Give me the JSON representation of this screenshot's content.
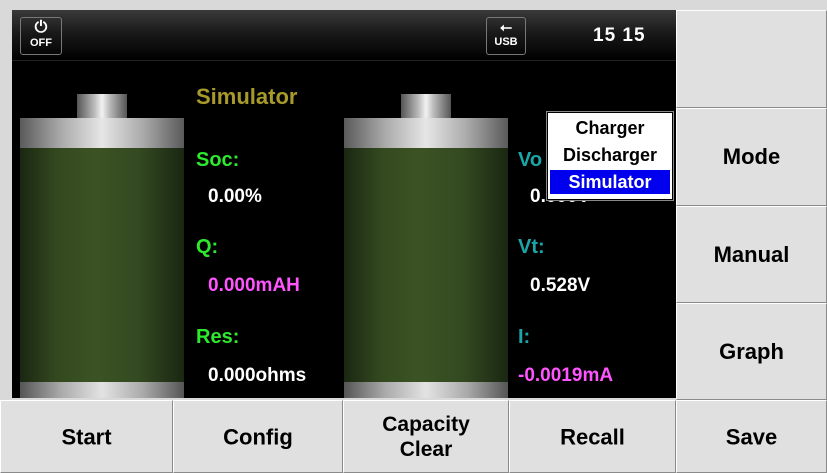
{
  "status": {
    "power_icon": "power-icon",
    "power_label": "OFF",
    "usb_icon": "usb-icon",
    "usb_label": "USB",
    "clock": "15 15"
  },
  "mode_title": "Simulator",
  "left_panel": {
    "soc_label": "Soc:",
    "soc_value": "0.00%",
    "q_label": "Q:",
    "q_value": "0.000mAH",
    "res_label": "Res:",
    "res_value": "0.000ohms"
  },
  "right_panel": {
    "voc_label": "Vo",
    "voc_value": "0.000V",
    "vt_label": "Vt:",
    "vt_value": "0.528V",
    "i_label": "I:",
    "i_value": "-0.0019mA"
  },
  "mode_popup": {
    "options": [
      "Charger",
      "Discharger",
      "Simulator"
    ],
    "selected": "Simulator"
  },
  "side_buttons": {
    "mode": "Mode",
    "manual": "Manual",
    "graph": "Graph"
  },
  "bottom_buttons": {
    "start": "Start",
    "config": "Config",
    "capacity_line1": "Capacity",
    "capacity_line2": "Clear",
    "recall": "Recall",
    "save": "Save"
  },
  "colors": {
    "label_green": "#2ee82e",
    "label_teal": "#1aa6a6",
    "value_magenta": "#ff55ff",
    "title_yellow": "#a89a2a",
    "popup_selected": "#0000ee"
  }
}
